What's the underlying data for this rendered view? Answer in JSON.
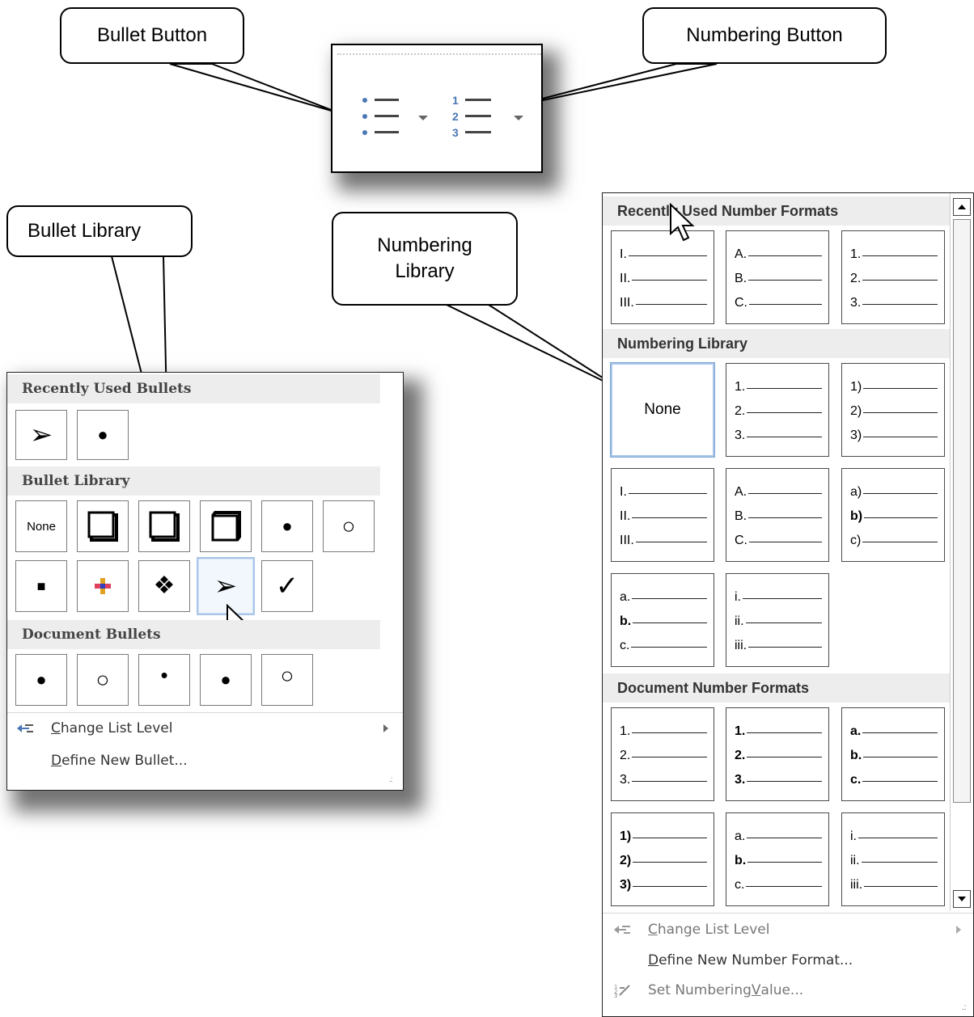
{
  "callouts": {
    "bullet_button": "Bullet Button",
    "numbering_button": "Numbering Button",
    "bullet_library": "Bullet Library",
    "numbering_library_1": "Numbering",
    "numbering_library_2": "Library"
  },
  "ribbon": {
    "numbers": [
      "1",
      "2",
      "3"
    ]
  },
  "bullet_panel": {
    "recent_heading": "Recently Used Bullets",
    "recent": [
      "➢",
      "●"
    ],
    "library_heading": "Bullet Library",
    "library_row1": [
      "None",
      "❑",
      "❑",
      "❒",
      "●",
      "○"
    ],
    "library_row2": [
      "■",
      "✚",
      "❖",
      "➢",
      "✓"
    ],
    "document_heading": "Document Bullets",
    "document": [
      "●",
      "○",
      "•",
      "●",
      "○"
    ],
    "menu": {
      "change_level_u": "C",
      "change_level_rest": "hange List Level",
      "define_u": "D",
      "define_rest": "efine New Bullet..."
    }
  },
  "number_panel": {
    "recent_heading": "Recently Used Number Formats",
    "library_heading": "Numbering Library",
    "document_heading": "Document Number Formats",
    "none_label": "None",
    "recent_tiles": [
      [
        "I.",
        "II.",
        "III."
      ],
      [
        "A.",
        "B.",
        "C."
      ],
      [
        "1.",
        "2.",
        "3."
      ]
    ],
    "library_tiles": [
      [
        "1.",
        "2.",
        "3."
      ],
      [
        "1)",
        "2)",
        "3)"
      ],
      [
        "I.",
        "II.",
        "III."
      ],
      [
        "A.",
        "B.",
        "C."
      ],
      [
        "a)",
        "b)",
        "c)"
      ],
      [
        "a.",
        "b.",
        "c."
      ],
      [
        "i.",
        "ii.",
        "iii."
      ]
    ],
    "document_tiles": [
      [
        "1.",
        "2.",
        "3."
      ],
      [
        "1.",
        "2.",
        "3."
      ],
      [
        "a.",
        "b.",
        "c."
      ],
      [
        "1)",
        "2)",
        "3)"
      ],
      [
        "a.",
        "b.",
        "c."
      ],
      [
        "i.",
        "ii.",
        "iii."
      ]
    ],
    "menu": {
      "change_level_u": "C",
      "change_level_rest": "hange List Level",
      "define_u": "D",
      "define_rest": "efine New Number Format...",
      "set_value_pre": "Set Numbering ",
      "set_value_u": "V",
      "set_value_rest": "alue..."
    }
  },
  "colors": {
    "icon_blue": "#4a78b5",
    "selection": "#a9c6e8"
  }
}
